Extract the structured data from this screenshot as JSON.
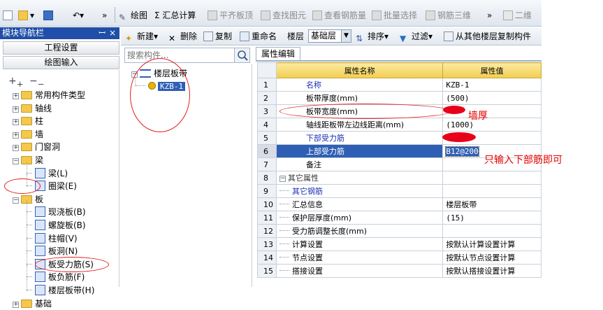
{
  "toolbar": {
    "overflow": "»",
    "draw": "绘图",
    "sum": "Σ 汇总计算",
    "align_top": "平齐板顶",
    "find": "查找图元",
    "view_rebar": "查看钢筋量",
    "batch_select": "批量选择",
    "rebar_3d": "钢筋三维",
    "view_2d": "二维"
  },
  "nav": {
    "title": "模块导航栏",
    "pin": "ꟷ",
    "close": "×",
    "project_settings": "工程设置",
    "drawing_input": "绘图输入",
    "tree": [
      {
        "label": "常用构件类型",
        "state": "+"
      },
      {
        "label": "轴线",
        "state": "+"
      },
      {
        "label": "柱",
        "state": "+"
      },
      {
        "label": "墙",
        "state": "+"
      },
      {
        "label": "门窗洞",
        "state": "+"
      },
      {
        "label": "梁",
        "state": "-"
      },
      {
        "label": "梁(L)",
        "child": true
      },
      {
        "label": "圈梁(E)",
        "child": true
      },
      {
        "label": "板",
        "state": "-"
      },
      {
        "label": "现浇板(B)",
        "child": true
      },
      {
        "label": "螺旋板(B)",
        "child": true
      },
      {
        "label": "柱帽(V)",
        "child": true
      },
      {
        "label": "板洞(N)",
        "child": true
      },
      {
        "label": "板受力筋(S)",
        "child": true
      },
      {
        "label": "板负筋(F)",
        "child": true
      },
      {
        "label": "楼层板带(H)",
        "child": true
      },
      {
        "label": "基础",
        "state": "+"
      }
    ]
  },
  "toolbar2": {
    "new": "新建",
    "delete": "删除",
    "copy": "复制",
    "rename": "重命名",
    "floor_label": "楼层",
    "floor_value": "基础层",
    "sort": "排序",
    "filter": "过滤",
    "copy_from": "从其他楼层复制构件"
  },
  "components": {
    "search_placeholder": "搜索构件...",
    "root": "楼层板带",
    "item": "KZB-1"
  },
  "props": {
    "tab": "属性编辑",
    "col_name": "属性名称",
    "col_value": "属性值",
    "rows": [
      {
        "n": "1",
        "name": "名称",
        "value": "KZB-1",
        "blue": true
      },
      {
        "n": "2",
        "name": "板带厚度(mm)",
        "value": "(500)"
      },
      {
        "n": "3",
        "name": "板带宽度(mm)",
        "value": ""
      },
      {
        "n": "4",
        "name": "轴线距板带左边线距离(mm)",
        "value": "(1000)"
      },
      {
        "n": "5",
        "name": "下部受力筋",
        "value": "",
        "blue": true
      },
      {
        "n": "6",
        "name": "上部受力筋",
        "value": "B12@200",
        "selected": true
      },
      {
        "n": "7",
        "name": "备注",
        "value": ""
      },
      {
        "n": "8",
        "name": "其它属性",
        "value": "",
        "group": true
      },
      {
        "n": "9",
        "name": "其它钢筋",
        "value": "",
        "blue": true,
        "sub": true
      },
      {
        "n": "10",
        "name": "汇总信息",
        "value": "楼层板带",
        "sub": true
      },
      {
        "n": "11",
        "name": "保护层厚度(mm)",
        "value": "(15)",
        "sub": true
      },
      {
        "n": "12",
        "name": "受力筋调整长度(mm)",
        "value": "",
        "sub": true
      },
      {
        "n": "13",
        "name": "计算设置",
        "value": "按默认计算设置计算",
        "sub": true
      },
      {
        "n": "14",
        "name": "节点设置",
        "value": "按默认节点设置计算",
        "sub": true
      },
      {
        "n": "15",
        "name": "搭接设置",
        "value": "按默认搭接设置计算",
        "sub": true
      }
    ]
  },
  "annotations": {
    "wall_thickness": "墙厚",
    "only_bottom": "只输入下部筋即可",
    "color": "#e80000"
  }
}
